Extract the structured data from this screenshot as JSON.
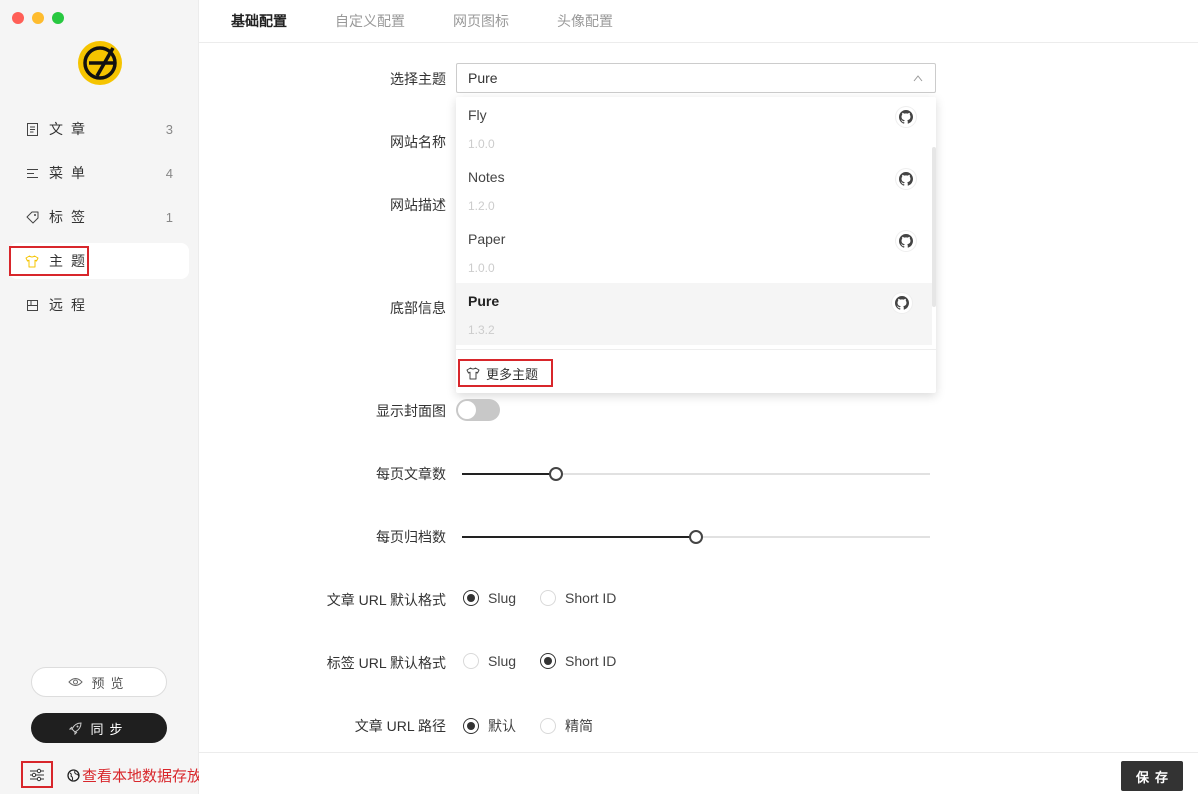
{
  "sidebar": {
    "items": [
      {
        "icon": "document-icon",
        "label": "文章",
        "count": "3"
      },
      {
        "icon": "menu-icon",
        "label": "菜单",
        "count": "4"
      },
      {
        "icon": "tag-icon",
        "label": "标签",
        "count": "1"
      },
      {
        "icon": "shirt-icon",
        "label": "主题",
        "count": ""
      },
      {
        "icon": "remote-icon",
        "label": "远程",
        "count": ""
      }
    ],
    "active_index": 3,
    "preview_label": "预览",
    "sync_label": "同步",
    "path_link": "查看本地数据存放路径"
  },
  "tabs": [
    {
      "label": "基础配置",
      "active": true
    },
    {
      "label": "自定义配置",
      "active": false
    },
    {
      "label": "网页图标",
      "active": false
    },
    {
      "label": "头像配置",
      "active": false
    }
  ],
  "form": {
    "theme_label": "选择主题",
    "theme_value": "Pure",
    "site_name_label": "网站名称",
    "site_desc_label": "网站描述",
    "footer_label": "底部信息",
    "cover_label": "显示封面图",
    "cover_enabled": false,
    "posts_per_page_label": "每页文章数",
    "posts_per_page_fraction": 0.2,
    "archives_per_page_label": "每页归档数",
    "archives_per_page_fraction": 0.5,
    "post_url_label": "文章 URL 默认格式",
    "post_url_options": [
      "Slug",
      "Short ID"
    ],
    "post_url_selected": "Slug",
    "tag_url_label": "标签 URL 默认格式",
    "tag_url_options": [
      "Slug",
      "Short ID"
    ],
    "tag_url_selected": "Short ID",
    "post_path_label": "文章 URL 路径",
    "post_path_options": [
      "默认",
      "精简"
    ],
    "post_path_selected": "默认"
  },
  "theme_dropdown": {
    "items": [
      {
        "name": "Fly",
        "version": "1.0.0"
      },
      {
        "name": "Notes",
        "version": "1.2.0"
      },
      {
        "name": "Paper",
        "version": "1.0.0"
      },
      {
        "name": "Pure",
        "version": "1.3.2"
      }
    ],
    "selected": "Pure",
    "more_label": "更多主题"
  },
  "save_label": "保存",
  "colors": {
    "accent": "#d8262b",
    "logo": "#f5c400"
  }
}
